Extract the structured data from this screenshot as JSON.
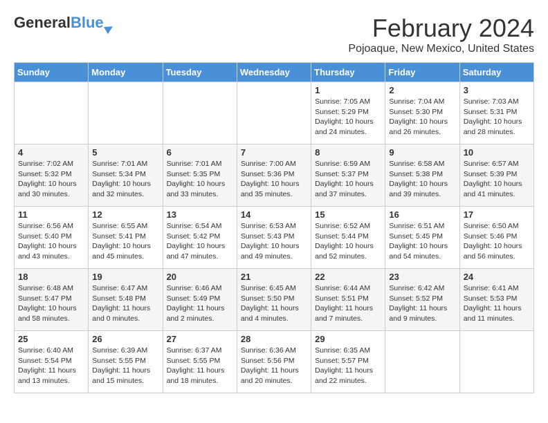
{
  "header": {
    "logo_general": "General",
    "logo_blue": "Blue",
    "month_title": "February 2024",
    "location": "Pojoaque, New Mexico, United States"
  },
  "calendar": {
    "days_of_week": [
      "Sunday",
      "Monday",
      "Tuesday",
      "Wednesday",
      "Thursday",
      "Friday",
      "Saturday"
    ],
    "weeks": [
      [
        {
          "day": "",
          "info": ""
        },
        {
          "day": "",
          "info": ""
        },
        {
          "day": "",
          "info": ""
        },
        {
          "day": "",
          "info": ""
        },
        {
          "day": "1",
          "info": "Sunrise: 7:05 AM\nSunset: 5:29 PM\nDaylight: 10 hours and 24 minutes."
        },
        {
          "day": "2",
          "info": "Sunrise: 7:04 AM\nSunset: 5:30 PM\nDaylight: 10 hours and 26 minutes."
        },
        {
          "day": "3",
          "info": "Sunrise: 7:03 AM\nSunset: 5:31 PM\nDaylight: 10 hours and 28 minutes."
        }
      ],
      [
        {
          "day": "4",
          "info": "Sunrise: 7:02 AM\nSunset: 5:32 PM\nDaylight: 10 hours and 30 minutes."
        },
        {
          "day": "5",
          "info": "Sunrise: 7:01 AM\nSunset: 5:34 PM\nDaylight: 10 hours and 32 minutes."
        },
        {
          "day": "6",
          "info": "Sunrise: 7:01 AM\nSunset: 5:35 PM\nDaylight: 10 hours and 33 minutes."
        },
        {
          "day": "7",
          "info": "Sunrise: 7:00 AM\nSunset: 5:36 PM\nDaylight: 10 hours and 35 minutes."
        },
        {
          "day": "8",
          "info": "Sunrise: 6:59 AM\nSunset: 5:37 PM\nDaylight: 10 hours and 37 minutes."
        },
        {
          "day": "9",
          "info": "Sunrise: 6:58 AM\nSunset: 5:38 PM\nDaylight: 10 hours and 39 minutes."
        },
        {
          "day": "10",
          "info": "Sunrise: 6:57 AM\nSunset: 5:39 PM\nDaylight: 10 hours and 41 minutes."
        }
      ],
      [
        {
          "day": "11",
          "info": "Sunrise: 6:56 AM\nSunset: 5:40 PM\nDaylight: 10 hours and 43 minutes."
        },
        {
          "day": "12",
          "info": "Sunrise: 6:55 AM\nSunset: 5:41 PM\nDaylight: 10 hours and 45 minutes."
        },
        {
          "day": "13",
          "info": "Sunrise: 6:54 AM\nSunset: 5:42 PM\nDaylight: 10 hours and 47 minutes."
        },
        {
          "day": "14",
          "info": "Sunrise: 6:53 AM\nSunset: 5:43 PM\nDaylight: 10 hours and 49 minutes."
        },
        {
          "day": "15",
          "info": "Sunrise: 6:52 AM\nSunset: 5:44 PM\nDaylight: 10 hours and 52 minutes."
        },
        {
          "day": "16",
          "info": "Sunrise: 6:51 AM\nSunset: 5:45 PM\nDaylight: 10 hours and 54 minutes."
        },
        {
          "day": "17",
          "info": "Sunrise: 6:50 AM\nSunset: 5:46 PM\nDaylight: 10 hours and 56 minutes."
        }
      ],
      [
        {
          "day": "18",
          "info": "Sunrise: 6:48 AM\nSunset: 5:47 PM\nDaylight: 10 hours and 58 minutes."
        },
        {
          "day": "19",
          "info": "Sunrise: 6:47 AM\nSunset: 5:48 PM\nDaylight: 11 hours and 0 minutes."
        },
        {
          "day": "20",
          "info": "Sunrise: 6:46 AM\nSunset: 5:49 PM\nDaylight: 11 hours and 2 minutes."
        },
        {
          "day": "21",
          "info": "Sunrise: 6:45 AM\nSunset: 5:50 PM\nDaylight: 11 hours and 4 minutes."
        },
        {
          "day": "22",
          "info": "Sunrise: 6:44 AM\nSunset: 5:51 PM\nDaylight: 11 hours and 7 minutes."
        },
        {
          "day": "23",
          "info": "Sunrise: 6:42 AM\nSunset: 5:52 PM\nDaylight: 11 hours and 9 minutes."
        },
        {
          "day": "24",
          "info": "Sunrise: 6:41 AM\nSunset: 5:53 PM\nDaylight: 11 hours and 11 minutes."
        }
      ],
      [
        {
          "day": "25",
          "info": "Sunrise: 6:40 AM\nSunset: 5:54 PM\nDaylight: 11 hours and 13 minutes."
        },
        {
          "day": "26",
          "info": "Sunrise: 6:39 AM\nSunset: 5:55 PM\nDaylight: 11 hours and 15 minutes."
        },
        {
          "day": "27",
          "info": "Sunrise: 6:37 AM\nSunset: 5:55 PM\nDaylight: 11 hours and 18 minutes."
        },
        {
          "day": "28",
          "info": "Sunrise: 6:36 AM\nSunset: 5:56 PM\nDaylight: 11 hours and 20 minutes."
        },
        {
          "day": "29",
          "info": "Sunrise: 6:35 AM\nSunset: 5:57 PM\nDaylight: 11 hours and 22 minutes."
        },
        {
          "day": "",
          "info": ""
        },
        {
          "day": "",
          "info": ""
        }
      ]
    ]
  }
}
